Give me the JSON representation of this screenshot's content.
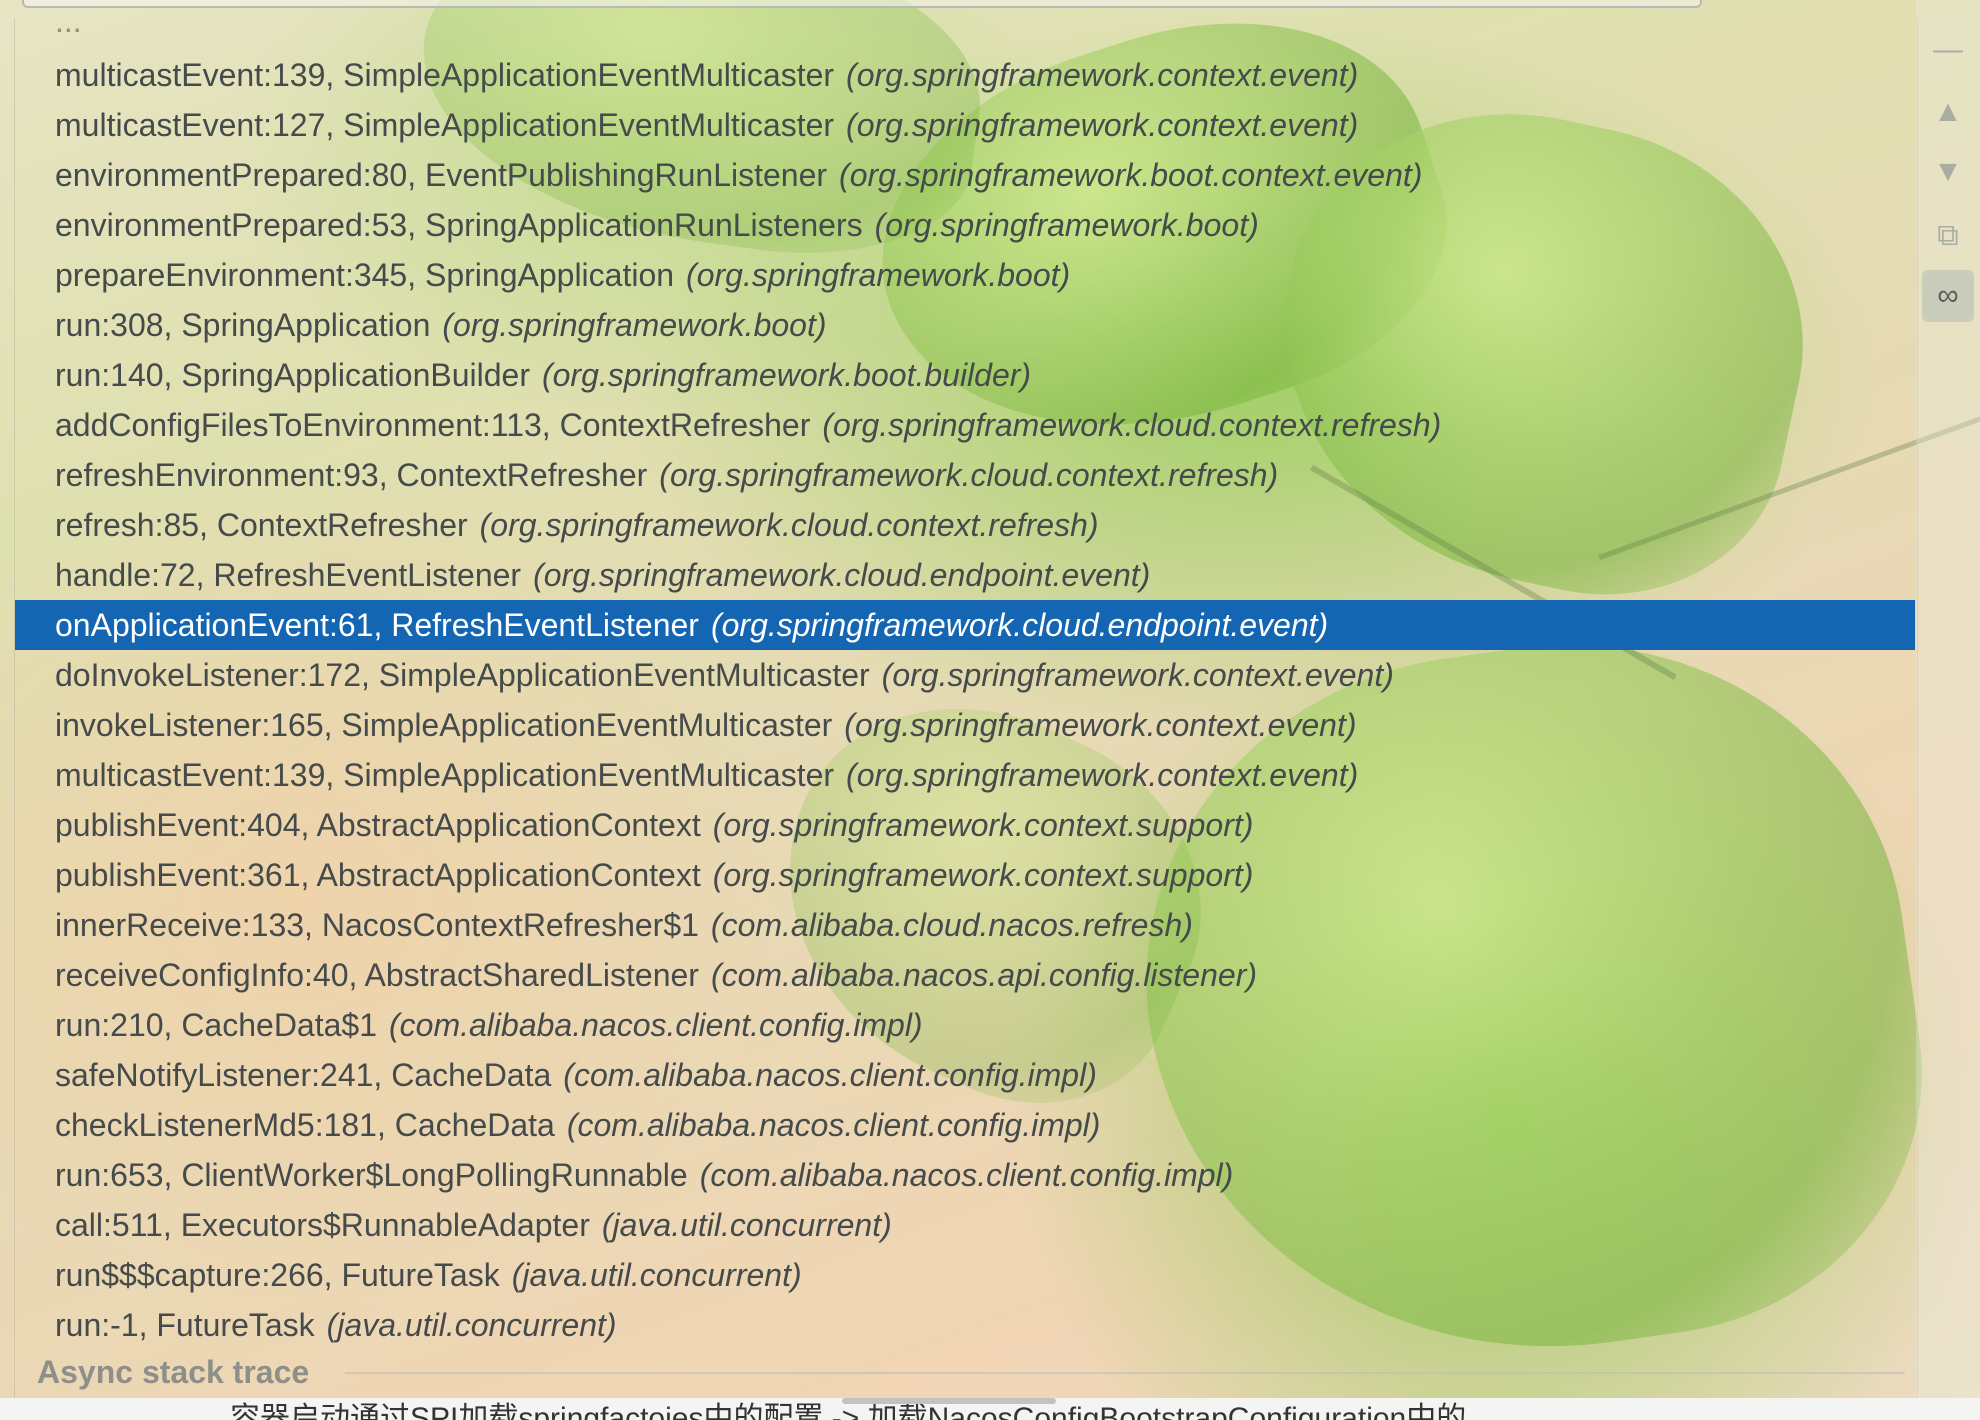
{
  "frames_panel": {
    "cut_off_top_row": "...",
    "rows": [
      {
        "method": "multicastEvent:139, SimpleApplicationEventMulticaster",
        "package": "(org.springframework.context.event)"
      },
      {
        "method": "multicastEvent:127, SimpleApplicationEventMulticaster",
        "package": "(org.springframework.context.event)"
      },
      {
        "method": "environmentPrepared:80, EventPublishingRunListener",
        "package": "(org.springframework.boot.context.event)"
      },
      {
        "method": "environmentPrepared:53, SpringApplicationRunListeners",
        "package": "(org.springframework.boot)"
      },
      {
        "method": "prepareEnvironment:345, SpringApplication",
        "package": "(org.springframework.boot)"
      },
      {
        "method": "run:308, SpringApplication",
        "package": "(org.springframework.boot)"
      },
      {
        "method": "run:140, SpringApplicationBuilder",
        "package": "(org.springframework.boot.builder)"
      },
      {
        "method": "addConfigFilesToEnvironment:113, ContextRefresher",
        "package": "(org.springframework.cloud.context.refresh)"
      },
      {
        "method": "refreshEnvironment:93, ContextRefresher",
        "package": "(org.springframework.cloud.context.refresh)"
      },
      {
        "method": "refresh:85, ContextRefresher",
        "package": "(org.springframework.cloud.context.refresh)"
      },
      {
        "method": "handle:72, RefreshEventListener",
        "package": "(org.springframework.cloud.endpoint.event)"
      },
      {
        "method": "onApplicationEvent:61, RefreshEventListener",
        "package": "(org.springframework.cloud.endpoint.event)",
        "selected": true
      },
      {
        "method": "doInvokeListener:172, SimpleApplicationEventMulticaster",
        "package": "(org.springframework.context.event)"
      },
      {
        "method": "invokeListener:165, SimpleApplicationEventMulticaster",
        "package": "(org.springframework.context.event)"
      },
      {
        "method": "multicastEvent:139, SimpleApplicationEventMulticaster",
        "package": "(org.springframework.context.event)"
      },
      {
        "method": "publishEvent:404, AbstractApplicationContext",
        "package": "(org.springframework.context.support)"
      },
      {
        "method": "publishEvent:361, AbstractApplicationContext",
        "package": "(org.springframework.context.support)"
      },
      {
        "method": "innerReceive:133, NacosContextRefresher$1",
        "package": "(com.alibaba.cloud.nacos.refresh)"
      },
      {
        "method": "receiveConfigInfo:40, AbstractSharedListener",
        "package": "(com.alibaba.nacos.api.config.listener)"
      },
      {
        "method": "run:210, CacheData$1",
        "package": "(com.alibaba.nacos.client.config.impl)"
      },
      {
        "method": "safeNotifyListener:241, CacheData",
        "package": "(com.alibaba.nacos.client.config.impl)"
      },
      {
        "method": "checkListenerMd5:181, CacheData",
        "package": "(com.alibaba.nacos.client.config.impl)"
      },
      {
        "method": "run:653, ClientWorker$LongPollingRunnable",
        "package": "(com.alibaba.nacos.client.config.impl)"
      },
      {
        "method": "call:511, Executors$RunnableAdapter",
        "package": "(java.util.concurrent)"
      },
      {
        "method": "run$$$capture:266, FutureTask",
        "package": "(java.util.concurrent)"
      },
      {
        "method": "run:-1, FutureTask",
        "package": "(java.util.concurrent)"
      }
    ],
    "async_label": "Async stack trace"
  },
  "side_toolbar": {
    "buttons": [
      {
        "icon": "minus-icon",
        "glyph": "—"
      },
      {
        "icon": "arrow-up-icon",
        "glyph": "▲"
      },
      {
        "icon": "arrow-down-icon",
        "glyph": "▼"
      },
      {
        "icon": "copy-stack-icon",
        "glyph": "⧉"
      },
      {
        "icon": "glasses-icon",
        "glyph": "∞",
        "active": true
      }
    ]
  },
  "bottom_text": "容器启动通过SPI加载springfactoies中的配置 -> 加载NacosConfigBootstrapConfiguration中的",
  "colors": {
    "selection": "#1466b3",
    "row_text": "#454a4a",
    "muted": "#8f8f8a"
  }
}
